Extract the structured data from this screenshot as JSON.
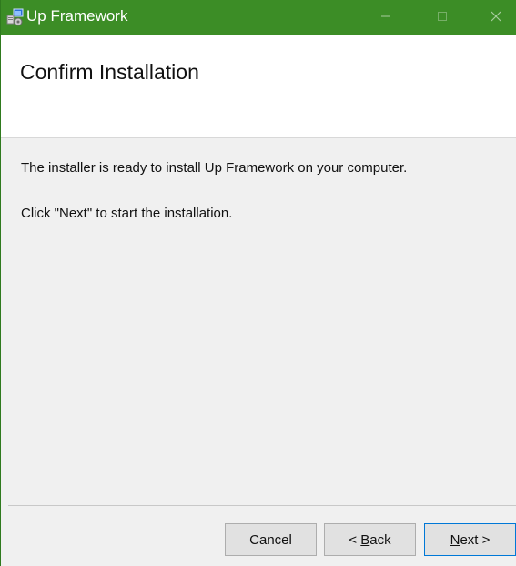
{
  "window": {
    "title": "Up Framework",
    "controls": {
      "minimize": "–",
      "maximize": "□",
      "close": "X"
    },
    "icon": "installer-icon"
  },
  "header": {
    "title": "Confirm Installation"
  },
  "main": {
    "line1": "The installer is ready to install Up Framework on your computer.",
    "line2": "Click \"Next\" to start the installation."
  },
  "buttons": {
    "cancel": "Cancel",
    "back_prefix": "< ",
    "back_mnemonic": "B",
    "back_rest": "ack",
    "next_mnemonic": "N",
    "next_rest": "ext >"
  },
  "colors": {
    "titlebar": "#3c8d26",
    "default_button_border": "#0078d7"
  }
}
